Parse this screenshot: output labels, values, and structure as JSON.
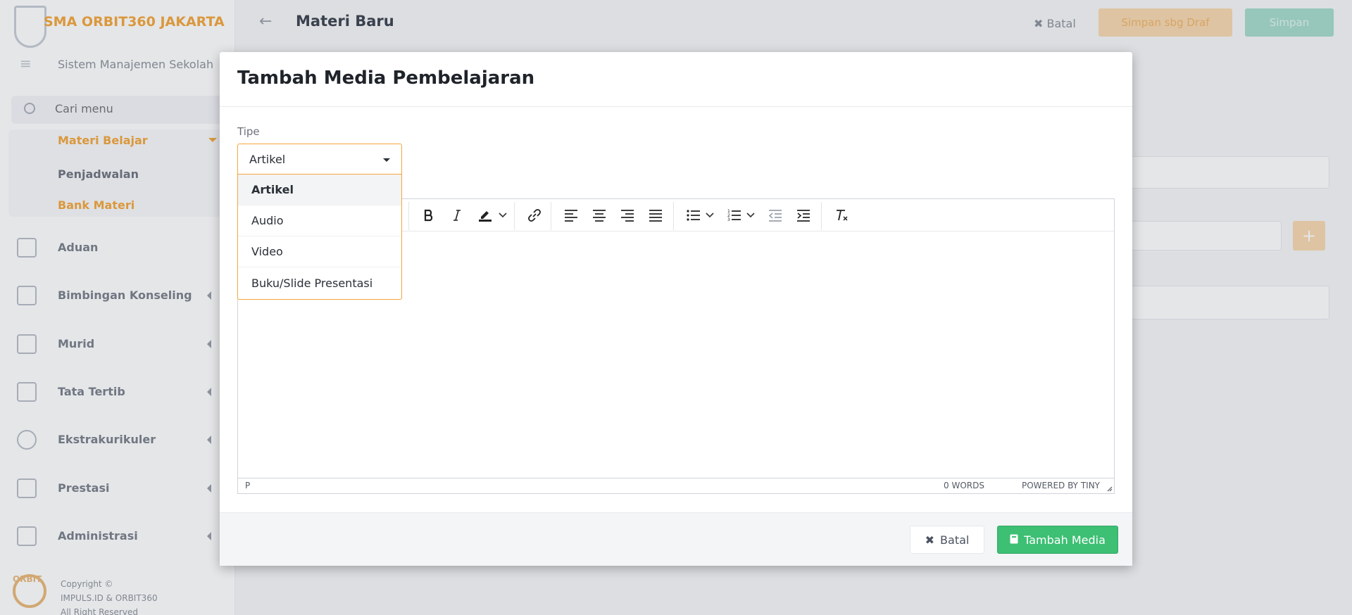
{
  "app": {
    "school_name": "SMA ORBIT360 JAKARTA",
    "subtitle": "Sistem Manajemen Sekolah",
    "search_placeholder": "Cari menu",
    "accent_color": "#f3a73c"
  },
  "sidebar": {
    "active_group": {
      "label": "Materi Belajar",
      "items": [
        "Penjadwalan",
        "Bank Materi"
      ]
    },
    "items": [
      {
        "label": "Aduan",
        "icon": "complaint-icon"
      },
      {
        "label": "Bimbingan Konseling",
        "icon": "counseling-icon"
      },
      {
        "label": "Murid",
        "icon": "student-icon"
      },
      {
        "label": "Tata Tertib",
        "icon": "rules-icon"
      },
      {
        "label": "Ekstrakurikuler",
        "icon": "extracurricular-icon"
      },
      {
        "label": "Prestasi",
        "icon": "trophy-icon"
      },
      {
        "label": "Administrasi",
        "icon": "admin-icon"
      }
    ],
    "footer": {
      "logo_text": "ORBIT",
      "line1": "Copyright ©",
      "line2": "IMPULS.ID & ORBIT360",
      "line3": "All Right Reserved"
    }
  },
  "page": {
    "title": "Materi Baru",
    "batal": "Batal",
    "save_draft": "Simpan sbg Draf",
    "save": "Simpan"
  },
  "modal": {
    "title": "Tambah Media Pembelajaran",
    "type_label": "Tipe",
    "type_value": "Artikel",
    "options": [
      "Artikel",
      "Audio",
      "Video",
      "Buku/Slide Presentasi"
    ],
    "selected_option": "Artikel",
    "editor": {
      "status_path": "P",
      "word_count": "0 WORDS",
      "powered": "POWERED BY TINY"
    },
    "cancel_label": "Batal",
    "add_label": "Tambah Media",
    "add_color": "#3dbf74"
  }
}
